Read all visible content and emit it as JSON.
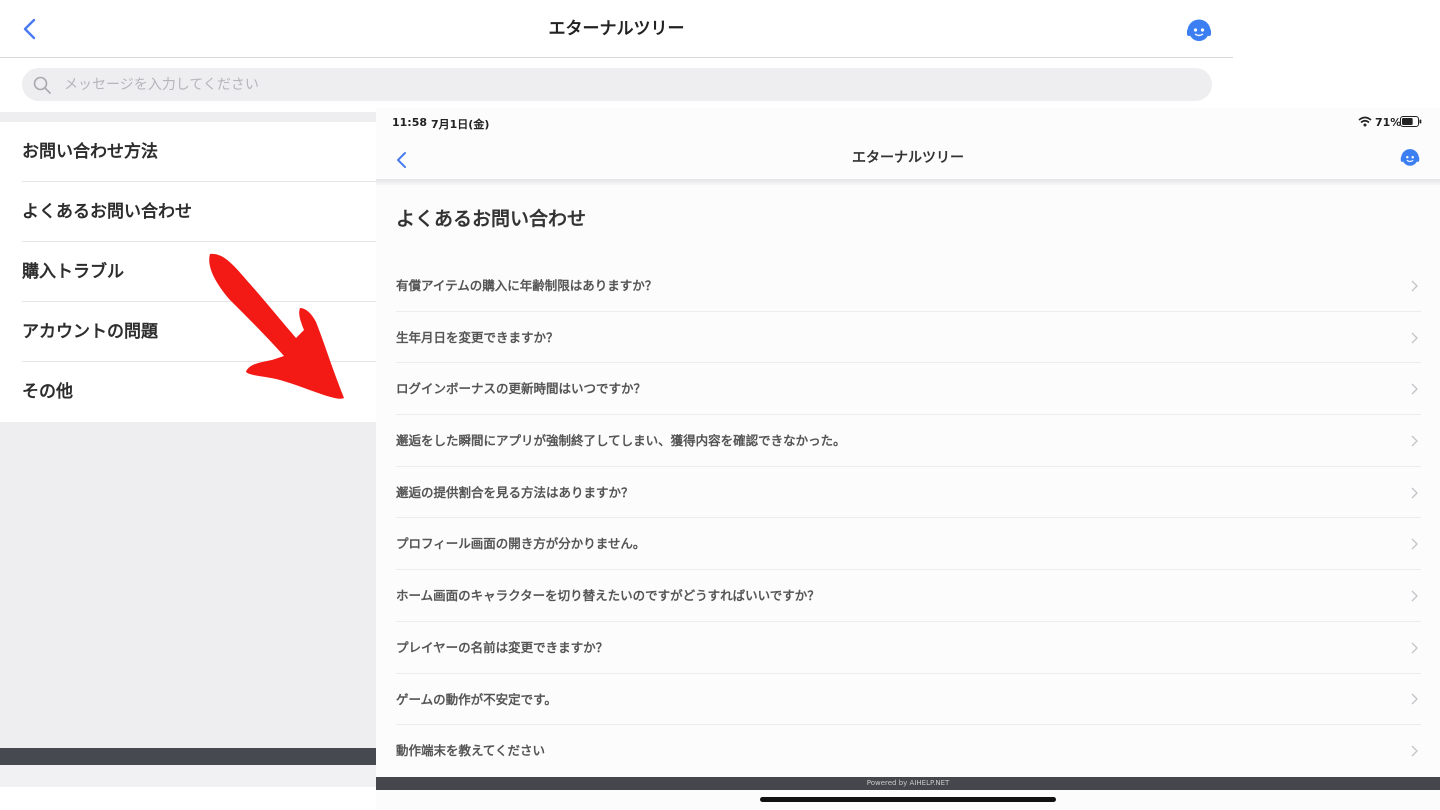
{
  "back_screen": {
    "nav": {
      "back_icon": "chevron-left-icon",
      "title": "エターナルツリー",
      "agent_icon": "support-agent-icon"
    },
    "search": {
      "icon": "search-icon",
      "placeholder": "メッセージを入力してください"
    },
    "categories": [
      {
        "label": "お問い合わせ方法"
      },
      {
        "label": "よくあるお問い合わせ"
      },
      {
        "label": "購入トラブル"
      },
      {
        "label": "アカウントの問題"
      },
      {
        "label": "その他"
      }
    ]
  },
  "annotation": {
    "arrow_icon": "red-arrow-icon",
    "color": "#f31a16"
  },
  "front_screen": {
    "status_bar": {
      "time": "11:58",
      "date": "7月1日(金)",
      "wifi_icon": "wifi-icon",
      "battery_percent": "71%",
      "battery_icon": "battery-icon",
      "battery_level": 0.71
    },
    "nav": {
      "back_icon": "chevron-left-icon",
      "title": "エターナルツリー",
      "agent_icon": "support-agent-icon"
    },
    "heading": "よくあるお問い合わせ",
    "faq_items": [
      {
        "label": "有償アイテムの購入に年齢制限はありますか？"
      },
      {
        "label": "生年月日を変更できますか？"
      },
      {
        "label": "ログインボーナスの更新時間はいつですか？"
      },
      {
        "label": "邂逅をした瞬間にアプリが強制終了してしまい、獲得内容を確認できなかった。"
      },
      {
        "label": "邂逅の提供割合を見る方法はありますか？"
      },
      {
        "label": "プロフィール画面の開き方が分かりません。"
      },
      {
        "label": "ホーム画面のキャラクターを切り替えたいのですがどうすればいいですか？"
      },
      {
        "label": "プレイヤーの名前は変更できますか？"
      },
      {
        "label": "ゲームの動作が不安定です。"
      },
      {
        "label": "動作端末を教えてください"
      }
    ],
    "footer": "Powered by AIHELP.NET"
  },
  "colors": {
    "accent": "#4a7cf0",
    "agent": "#3b7ff2"
  }
}
